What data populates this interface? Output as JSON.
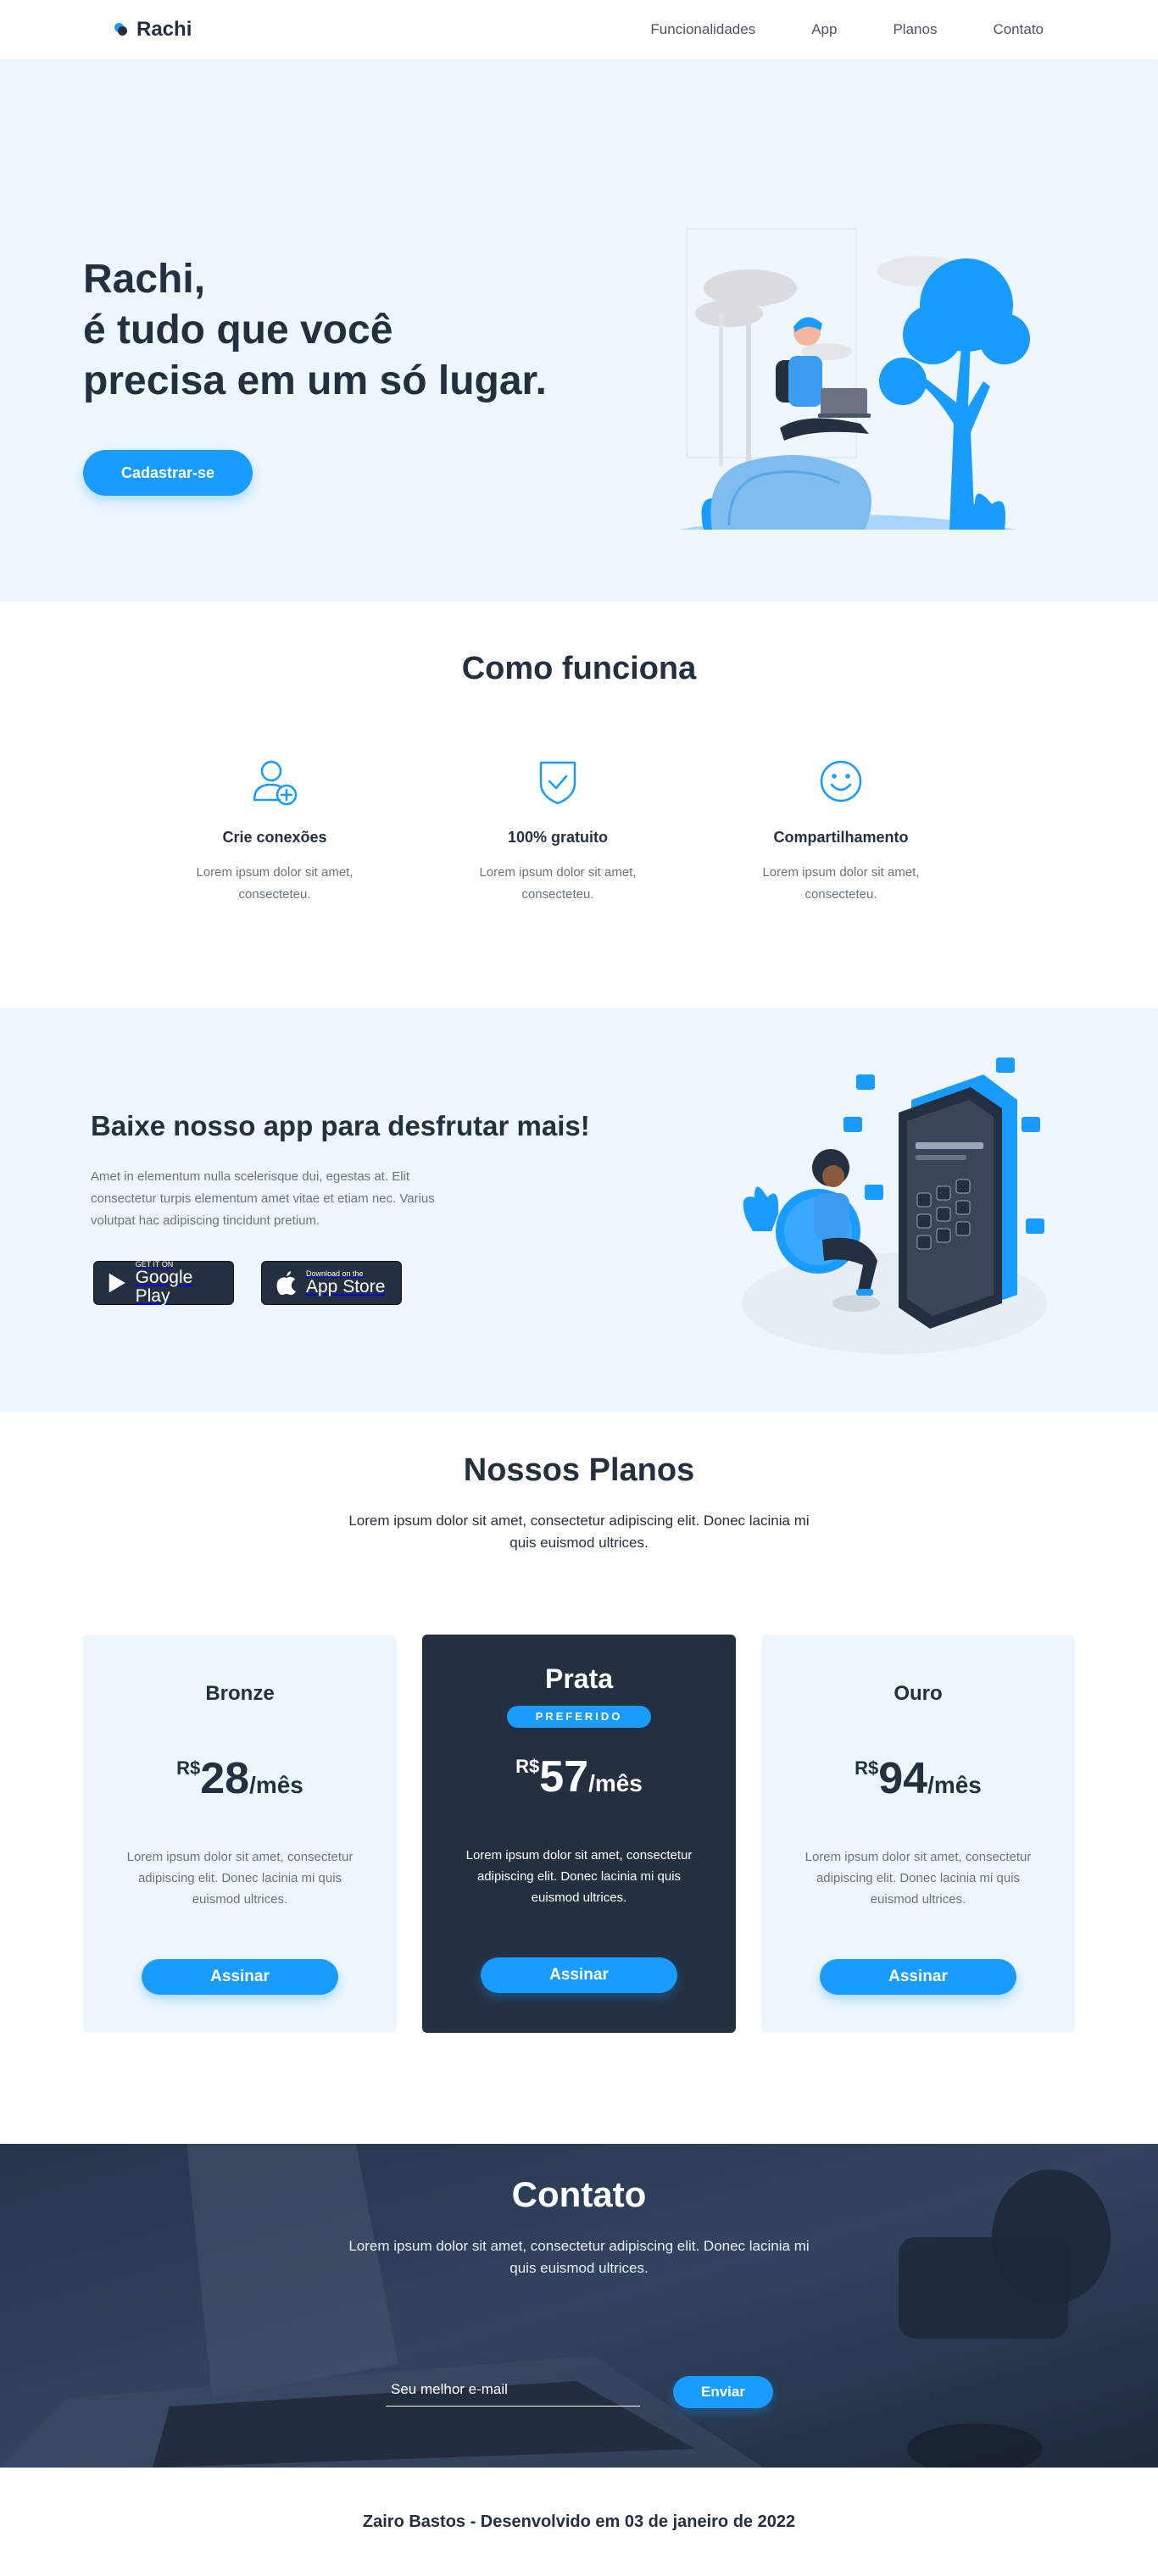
{
  "brand": {
    "name": "Rachi"
  },
  "nav": {
    "items": [
      "Funcionalidades",
      "App",
      "Planos",
      "Contato"
    ]
  },
  "hero": {
    "title_lines": [
      "Rachi,",
      "é tudo que você",
      "precisa em um só lugar."
    ],
    "cta": "Cadastrar-se"
  },
  "how": {
    "title": "Como funciona",
    "features": [
      {
        "icon": "user-add-icon",
        "title": "Crie conexões",
        "desc": "Lorem ipsum dolor sit amet, consecteteu."
      },
      {
        "icon": "shield-check-icon",
        "title": "100% gratuito",
        "desc": "Lorem ipsum dolor sit amet, consecteteu."
      },
      {
        "icon": "smile-icon",
        "title": "Compartilhamento",
        "desc": "Lorem ipsum dolor sit amet, consecteteu."
      }
    ]
  },
  "app": {
    "title": "Baixe nosso app para desfrutar mais!",
    "desc": "Amet in elementum nulla scelerisque dui, egestas at. Elit consectetur turpis elementum amet vitae et etiam nec. Varius volutpat hac adipiscing tincidunt pretium.",
    "google_play": {
      "small": "GET IT ON",
      "big": "Google Play"
    },
    "app_store": {
      "small": "Download on the",
      "big": "App Store"
    }
  },
  "plans": {
    "title": "Nossos Planos",
    "subtitle": "Lorem ipsum dolor sit amet, consectetur adipiscing elit. Donec lacinia mi quis euismod ultrices.",
    "cards": [
      {
        "name": "Bronze",
        "currency": "R$",
        "price": "28",
        "period": "/mês",
        "desc": "Lorem ipsum dolor sit amet, consectetur adipiscing elit. Donec lacinia mi quis euismod ultrices.",
        "cta": "Assinar"
      },
      {
        "name": "Prata",
        "badge": "PREFERIDO",
        "currency": "R$",
        "price": "57",
        "period": "/mês",
        "desc": "Lorem ipsum dolor sit amet, consectetur adipiscing elit. Donec lacinia mi quis euismod ultrices.",
        "cta": "Assinar"
      },
      {
        "name": "Ouro",
        "currency": "R$",
        "price": "94",
        "period": "/mês",
        "desc": "Lorem ipsum dolor sit amet, consectetur adipiscing elit. Donec lacinia mi quis euismod ultrices.",
        "cta": "Assinar"
      }
    ]
  },
  "contact": {
    "title": "Contato",
    "subtitle": "Lorem ipsum dolor sit amet, consectetur adipiscing elit. Donec lacinia mi quis euismod ultrices.",
    "email_placeholder": "Seu melhor e-mail",
    "send": "Enviar"
  },
  "footer": {
    "text": "Zairo Bastos - Desenvolvido em 03 de janeiro de 2022"
  },
  "colors": {
    "primary": "#1a9bff",
    "dark": "#243040",
    "light_bg": "#eef6fe"
  }
}
